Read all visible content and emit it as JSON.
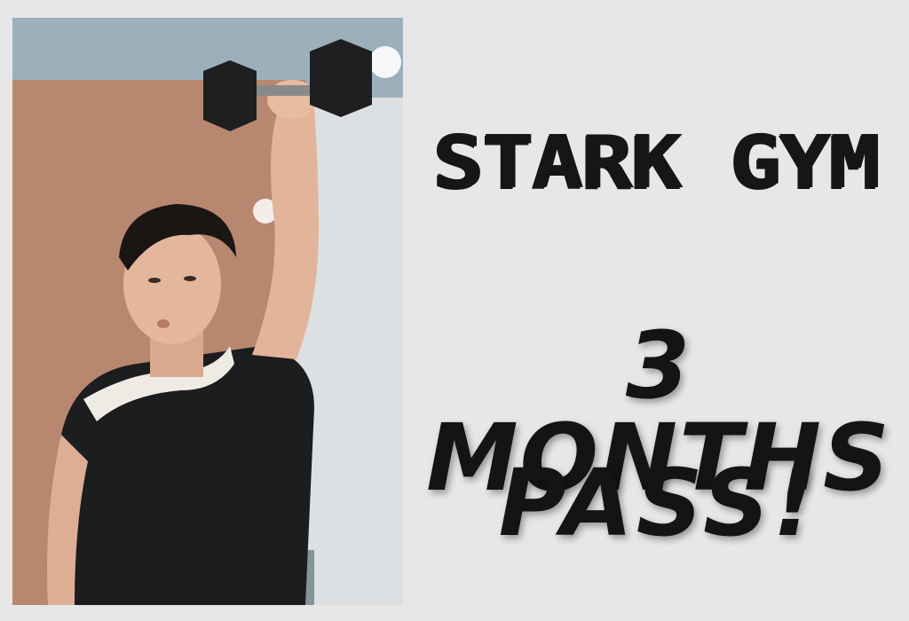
{
  "brand": {
    "name": "STARK GYM"
  },
  "offer": {
    "line1": "3 MONTHS",
    "line2": "PASS!"
  },
  "photo": {
    "subject": "man-lifting-dumbbell"
  },
  "colors": {
    "text": "#141414",
    "background": "#e7e7e7",
    "shirt": "#1c1d1f",
    "brick": "#b9896f"
  }
}
